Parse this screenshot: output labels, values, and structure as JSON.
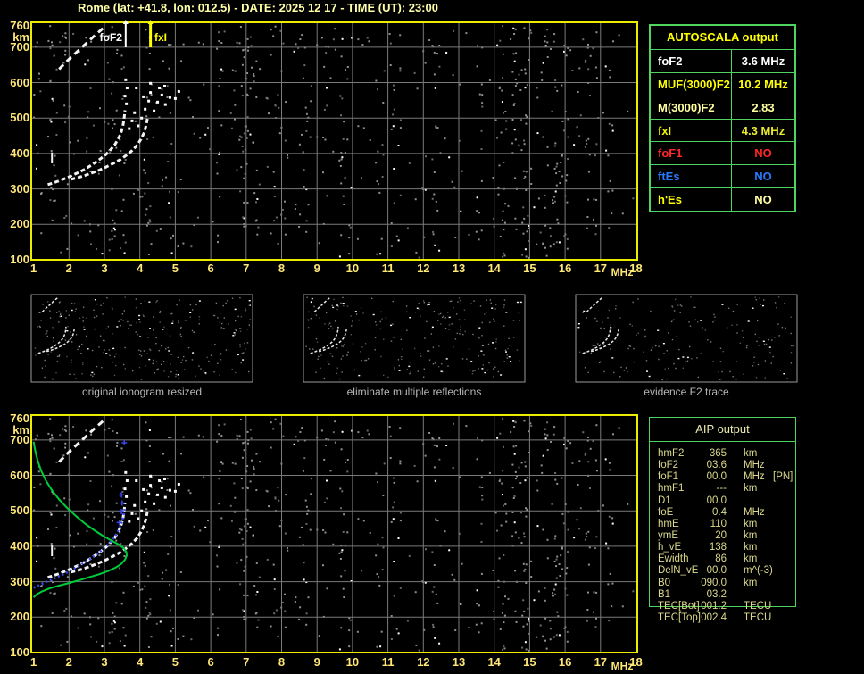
{
  "title": "Rome (lat: +41.8, lon: 012.5) - DATE: 2025 12 17 - TIME (UT): 23:00",
  "colors": {
    "background": "#000000",
    "plot_border": "#ecec00",
    "grid": "#7a7a7a",
    "axis_text": "#ffe878",
    "table_border": "#4fd45f",
    "trace_white": "#f2f2f2",
    "profile_green": "#00cc3a",
    "overlay_blue": "#3a49ee",
    "caption_gray": "#b8b8b8"
  },
  "autoscala": {
    "header": "AUTOSCALA output",
    "rows": [
      {
        "label": "foF2",
        "value": "3.6 MHz",
        "label_color": "#ffffff",
        "value_color": "#ffffff"
      },
      {
        "label": "MUF(3000)F2",
        "value": "10.2 MHz",
        "label_color": "#ffff00",
        "value_color": "#ffff00"
      },
      {
        "label": "M(3000)F2",
        "value": "2.83",
        "label_color": "#ffffa0",
        "value_color": "#ffffa0"
      },
      {
        "label": "fxI",
        "value": "4.3 MHz",
        "label_color": "#f4f400",
        "value_color": "#e8e830"
      },
      {
        "label": "foF1",
        "value": "NO",
        "label_color": "#ff2828",
        "value_color": "#ff2828"
      },
      {
        "label": "ftEs",
        "value": "NO",
        "label_color": "#2979ff",
        "value_color": "#2979ff"
      },
      {
        "label": "h'Es",
        "value": "NO",
        "label_color": "#ffff00",
        "value_color": "#ffffa0"
      }
    ]
  },
  "aip": {
    "header": "AIP output",
    "rows": [
      {
        "label": "hmF2",
        "value": "365",
        "unit": "km",
        "extra": ""
      },
      {
        "label": "foF2",
        "value": "03.6",
        "unit": "MHz",
        "extra": ""
      },
      {
        "label": "foF1",
        "value": "00.0",
        "unit": "MHz",
        "extra": "[PN]"
      },
      {
        "label": "hmF1",
        "value": "---",
        "unit": "km",
        "extra": ""
      },
      {
        "label": "D1",
        "value": "00.0",
        "unit": "",
        "extra": ""
      },
      {
        "label": "foE",
        "value": "0.4",
        "unit": "MHz",
        "extra": ""
      },
      {
        "label": "hmE",
        "value": "110",
        "unit": "km",
        "extra": ""
      },
      {
        "label": "ymE",
        "value": "20",
        "unit": "km",
        "extra": ""
      },
      {
        "label": "h_vE",
        "value": "138",
        "unit": "km",
        "extra": ""
      },
      {
        "label": "Ewidth",
        "value": "86",
        "unit": "km",
        "extra": ""
      },
      {
        "label": "DelN_vE",
        "value": "00.0",
        "unit": "m^(-3)",
        "extra": ""
      },
      {
        "label": "B0",
        "value": "090.0",
        "unit": "km",
        "extra": ""
      },
      {
        "label": "B1",
        "value": "03.2",
        "unit": "",
        "extra": ""
      },
      {
        "label": "TEC[Bot]",
        "value": "001.2",
        "unit": "TECU",
        "extra": ""
      },
      {
        "label": "TEC[Top]",
        "value": "002.4",
        "unit": "TECU",
        "extra": ""
      }
    ]
  },
  "thumbnails": [
    {
      "caption": "original ionogram resized"
    },
    {
      "caption": "eliminate multiple reflections"
    },
    {
      "caption": "evidence F2 trace"
    }
  ],
  "plots": {
    "x_unit": "MHz",
    "y_unit": "km",
    "x_ticks": [
      1,
      2,
      3,
      4,
      5,
      6,
      7,
      8,
      9,
      10,
      11,
      12,
      13,
      14,
      15,
      16,
      17,
      18
    ],
    "y_ticks": [
      760,
      700,
      600,
      500,
      400,
      300,
      200,
      100
    ],
    "markers": [
      {
        "label": "foF2",
        "freq": 3.6,
        "color": "#ffffff"
      },
      {
        "label": "fxI",
        "freq": 4.3,
        "color": "#ffff00"
      }
    ],
    "traces": {
      "o_mode": [
        [
          1.4,
          312
        ],
        [
          1.55,
          317
        ],
        [
          1.7,
          322
        ],
        [
          1.85,
          328
        ],
        [
          2.0,
          334
        ],
        [
          2.15,
          341
        ],
        [
          2.3,
          348
        ],
        [
          2.45,
          356
        ],
        [
          2.6,
          365
        ],
        [
          2.75,
          375
        ],
        [
          2.9,
          386
        ],
        [
          3.05,
          398
        ],
        [
          3.18,
          411
        ],
        [
          3.3,
          426
        ],
        [
          3.4,
          443
        ],
        [
          3.48,
          462
        ],
        [
          3.53,
          482
        ],
        [
          3.56,
          502
        ],
        [
          3.58,
          522
        ]
      ],
      "x_mode": [
        [
          2.05,
          327
        ],
        [
          2.25,
          332
        ],
        [
          2.45,
          338
        ],
        [
          2.65,
          345
        ],
        [
          2.85,
          353
        ],
        [
          3.05,
          362
        ],
        [
          3.25,
          372
        ],
        [
          3.45,
          383
        ],
        [
          3.62,
          395
        ],
        [
          3.78,
          408
        ],
        [
          3.92,
          423
        ],
        [
          4.03,
          440
        ],
        [
          4.12,
          459
        ],
        [
          4.18,
          480
        ],
        [
          4.22,
          502
        ]
      ],
      "multiple_reflection": [
        [
          1.72,
          638
        ],
        [
          1.85,
          651
        ],
        [
          1.98,
          664
        ],
        [
          2.11,
          676
        ],
        [
          2.24,
          688
        ],
        [
          2.37,
          700
        ],
        [
          2.5,
          712
        ],
        [
          2.63,
          724
        ],
        [
          2.76,
          736
        ],
        [
          2.89,
          747
        ],
        [
          3.0,
          757
        ]
      ],
      "vertical_echo": [
        [
          1.52,
          403
        ],
        [
          1.52,
          372
        ]
      ],
      "spread_scatter": [
        [
          3.62,
          540
        ],
        [
          3.58,
          562
        ],
        [
          3.64,
          585
        ],
        [
          3.6,
          608
        ],
        [
          3.7,
          470
        ],
        [
          3.78,
          492
        ],
        [
          3.85,
          515
        ],
        [
          3.95,
          478
        ],
        [
          4.05,
          500
        ],
        [
          4.15,
          525
        ],
        [
          4.25,
          548
        ],
        [
          4.3,
          572
        ],
        [
          4.4,
          520
        ],
        [
          4.5,
          545
        ],
        [
          4.62,
          565
        ],
        [
          4.72,
          538
        ],
        [
          4.85,
          558
        ],
        [
          4.3,
          598
        ],
        [
          4.55,
          585
        ],
        [
          4.1,
          560
        ],
        [
          3.9,
          585
        ],
        [
          4.7,
          590
        ],
        [
          5.0,
          555
        ],
        [
          5.1,
          575
        ]
      ],
      "green_profile": [
        [
          1.0,
          695
        ],
        [
          1.05,
          668
        ],
        [
          1.12,
          640
        ],
        [
          1.22,
          612
        ],
        [
          1.35,
          585
        ],
        [
          1.52,
          558
        ],
        [
          1.72,
          532
        ],
        [
          1.95,
          508
        ],
        [
          2.2,
          485
        ],
        [
          2.45,
          464
        ],
        [
          2.7,
          446
        ],
        [
          2.95,
          430
        ],
        [
          3.2,
          416
        ],
        [
          3.42,
          404
        ],
        [
          3.55,
          394
        ],
        [
          3.62,
          384
        ],
        [
          3.63,
          374
        ],
        [
          3.58,
          362
        ],
        [
          3.47,
          350
        ],
        [
          3.32,
          340
        ],
        [
          3.1,
          330
        ],
        [
          2.85,
          321
        ],
        [
          2.55,
          312
        ],
        [
          2.25,
          303
        ],
        [
          1.95,
          295
        ],
        [
          1.68,
          288
        ],
        [
          1.45,
          281
        ],
        [
          1.25,
          273
        ],
        [
          1.1,
          265
        ],
        [
          1.0,
          256
        ]
      ],
      "blue_overlay": [
        [
          1.0,
          283
        ],
        [
          1.15,
          290
        ],
        [
          1.3,
          297
        ],
        [
          1.45,
          303
        ],
        [
          1.6,
          310
        ],
        [
          1.75,
          317
        ],
        [
          1.9,
          324
        ],
        [
          2.05,
          332
        ],
        [
          2.2,
          340
        ],
        [
          2.35,
          349
        ],
        [
          2.5,
          358
        ],
        [
          2.65,
          368
        ],
        [
          2.8,
          379
        ],
        [
          2.95,
          391
        ],
        [
          3.1,
          404
        ],
        [
          3.22,
          418
        ],
        [
          3.33,
          433
        ],
        [
          3.42,
          450
        ],
        [
          3.49,
          468
        ],
        [
          3.54,
          487
        ],
        [
          3.57,
          505
        ]
      ],
      "blue_markers": [
        [
          3.42,
          467
        ],
        [
          3.48,
          498
        ],
        [
          3.5,
          522
        ],
        [
          3.48,
          545
        ],
        [
          3.56,
          692
        ]
      ]
    }
  }
}
